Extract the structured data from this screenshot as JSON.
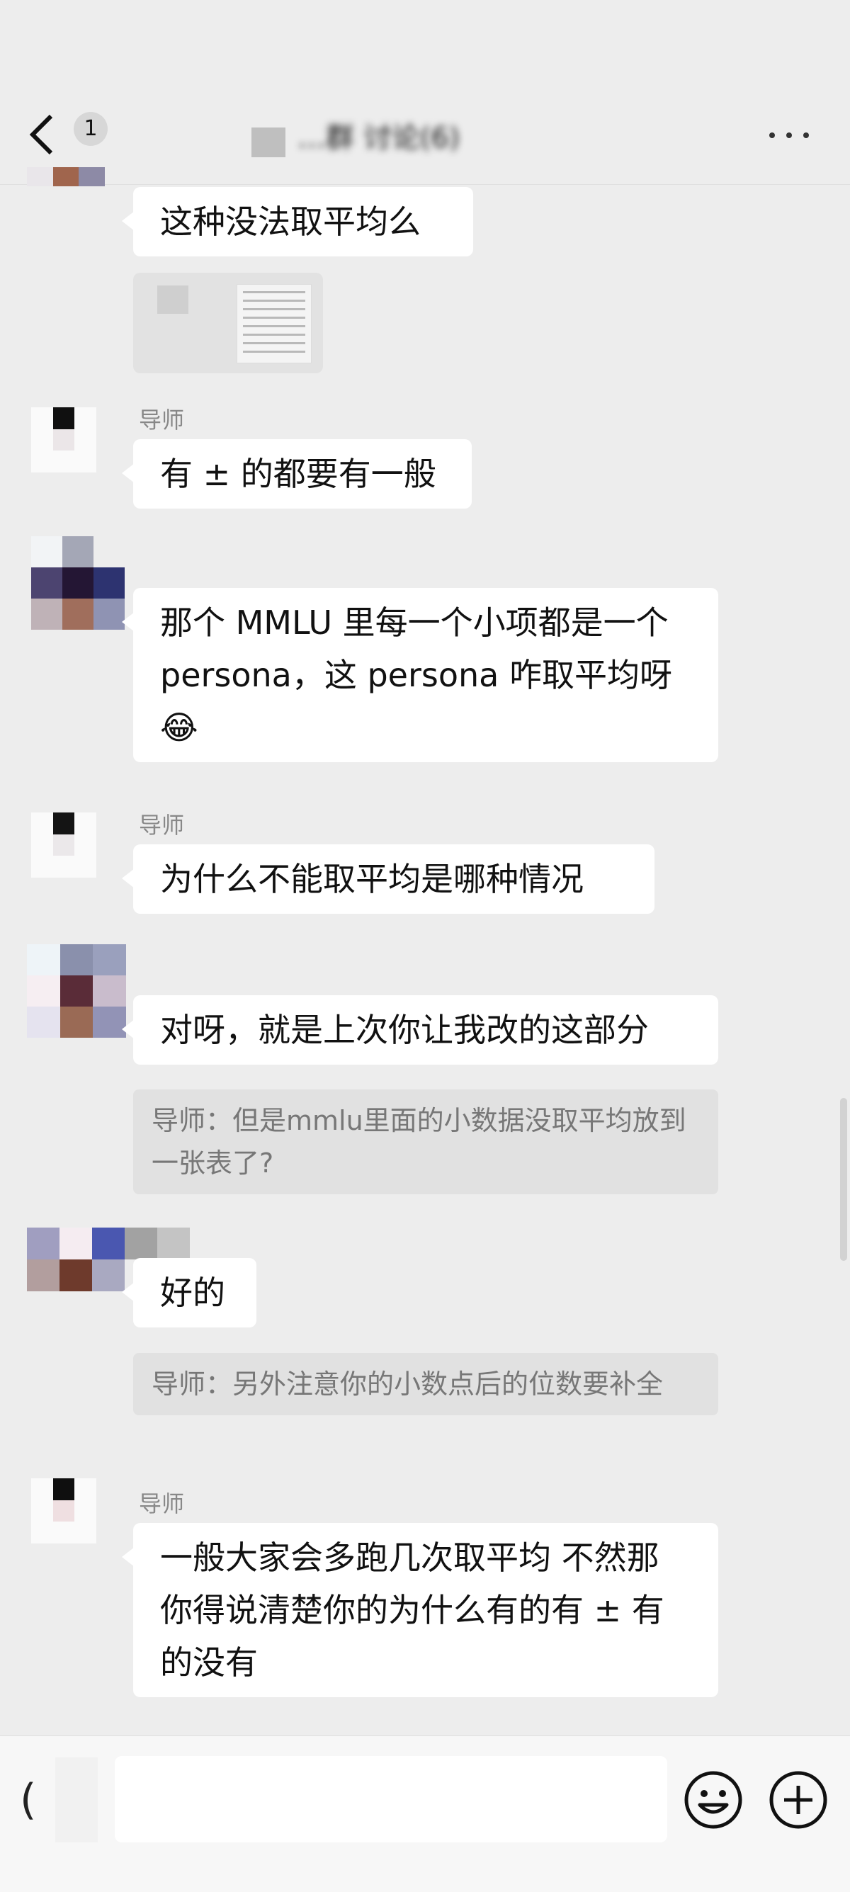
{
  "header": {
    "unread_count": "1",
    "title": "…群 讨论(6)",
    "more_label": "···"
  },
  "messages": [
    {
      "id": "m1",
      "sender": "",
      "text": "这种没法取平均么"
    },
    {
      "id": "m2",
      "type": "image"
    },
    {
      "id": "m3",
      "sender": "导师",
      "text": "有 ± 的都要有一般"
    },
    {
      "id": "m4",
      "sender": "",
      "text": "那个 MMLU 里每一个小项都是一个persona，这 persona 咋取平均呀😂"
    },
    {
      "id": "m5",
      "sender": "导师",
      "text": "为什么不能取平均是哪种情况"
    },
    {
      "id": "m6",
      "sender": "",
      "text": "对呀，就是上次你让我改的这部分",
      "quote": "导师：但是mmlu里面的小数据没取平均放到一张表了?"
    },
    {
      "id": "m7",
      "sender": "",
      "text": "好的",
      "quote": "导师：另外注意你的小数点后的位数要补全"
    },
    {
      "id": "m8",
      "sender": "导师",
      "text": "一般大家会多跑几次取平均 不然那你得说清楚你的为什么有的有 ± 有的没有"
    }
  ],
  "input": {
    "placeholder": "",
    "voice_glyph": "("
  },
  "colors": {
    "background": "#ededed",
    "bubble": "#ffffff",
    "quote": "#e1e1e1",
    "sender": "#888888",
    "input_bar": "#f7f7f7"
  },
  "icons": [
    "back-arrow-icon",
    "more-icon",
    "emoji-icon",
    "plus-icon",
    "voice-icon"
  ]
}
